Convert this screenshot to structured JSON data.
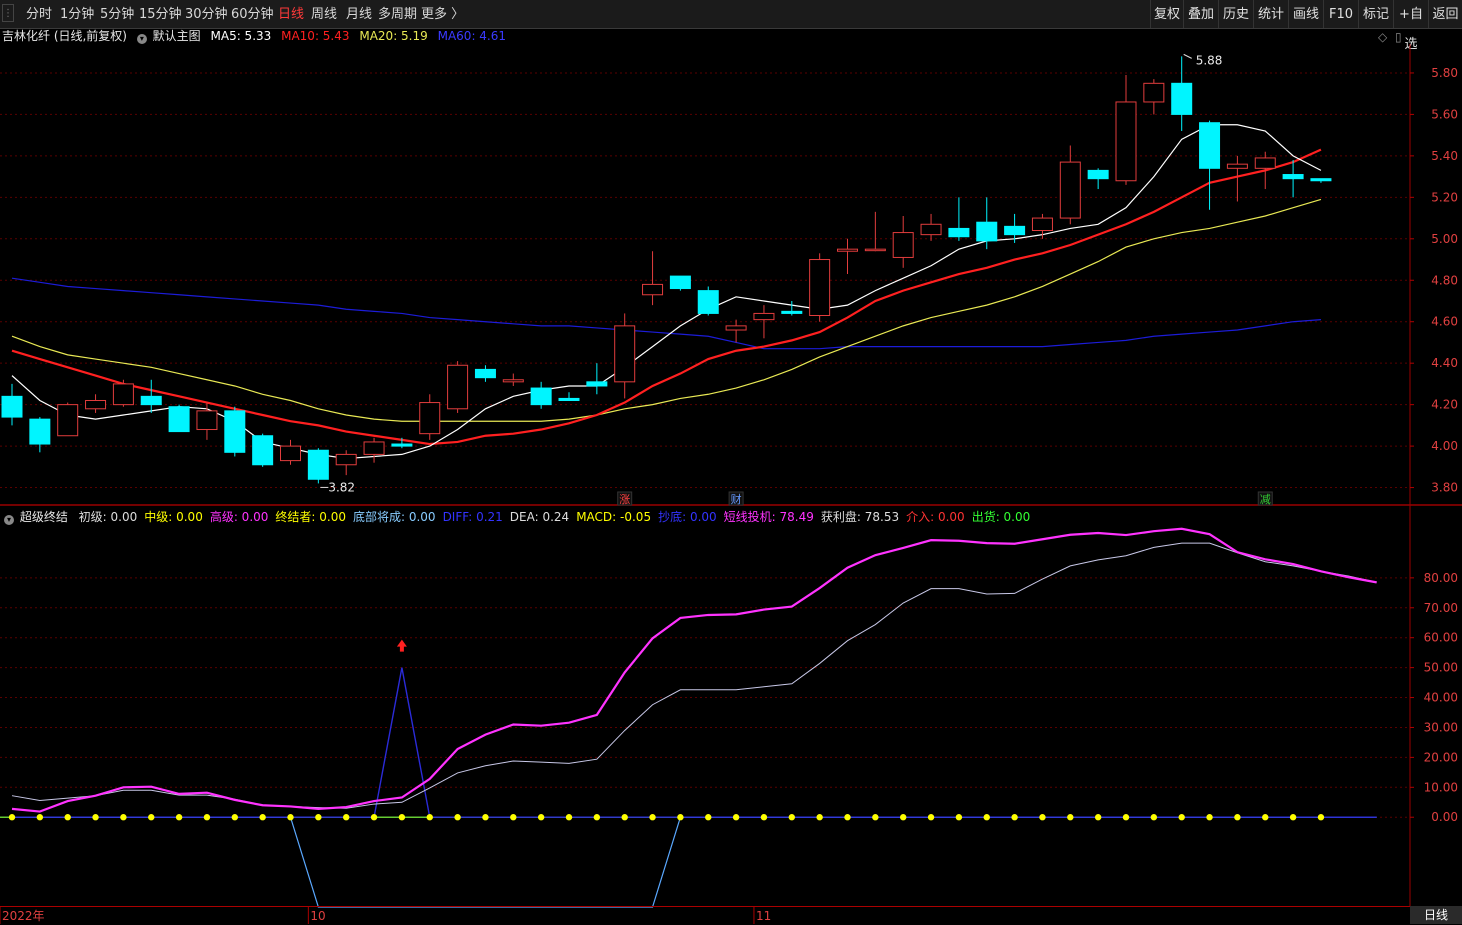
{
  "toolbar": {
    "timeframes": [
      "分时",
      "1分钟",
      "5分钟",
      "15分钟",
      "30分钟",
      "60分钟",
      "日线",
      "周线",
      "月线",
      "多周期",
      "更多 〉"
    ],
    "active_index": 6,
    "right_buttons": [
      "复权",
      "叠加",
      "历史",
      "统计",
      "画线",
      "F10",
      "标记",
      "+自选",
      "返回"
    ]
  },
  "colors": {
    "up": "#e23d3d",
    "down": "#00f5ff",
    "ma5": "#ffffff",
    "ma10": "#ff2020",
    "ma20": "#e8e854",
    "ma60": "#1c1cd8",
    "strategy": "#ff33ff",
    "profit": "#c8c8e8",
    "bottom_line": "#2b2bd8",
    "zero_line": "#66cc33",
    "dot": "#ffff00"
  },
  "main_info": {
    "stock": "吉林化纤 (日线,前复权)",
    "template": "默认主图",
    "ma5": "MA5: 5.33",
    "ma10": "MA10: 5.43",
    "ma20": "MA20: 5.19",
    "ma60": "MA60: 4.61"
  },
  "sub_info": {
    "name": "超级终结",
    "items": [
      {
        "label": "初级: 0.00",
        "color": "#dddddd"
      },
      {
        "label": "中级: 0.00",
        "color": "#ffff00"
      },
      {
        "label": "高级: 0.00",
        "color": "#ff33ff"
      },
      {
        "label": "终结者: 0.00",
        "color": "#ffff00"
      },
      {
        "label": "底部将成: 0.00",
        "color": "#88ccff"
      },
      {
        "label": "DIFF: 0.21",
        "color": "#3333ff"
      },
      {
        "label": "DEA: 0.24",
        "color": "#dddddd"
      },
      {
        "label": "MACD: -0.05",
        "color": "#ffff00"
      },
      {
        "label": "抄底: 0.00",
        "color": "#3333ff"
      },
      {
        "label": "短线投机: 78.49",
        "color": "#ff33ff"
      },
      {
        "label": "获利盘: 78.53",
        "color": "#dddddd"
      },
      {
        "label": "介入: 0.00",
        "color": "#ff3333"
      },
      {
        "label": "出货: 0.00",
        "color": "#33ff33"
      }
    ]
  },
  "markers": [
    {
      "label": "涨",
      "index": 22,
      "color": "#ff4040"
    },
    {
      "label": "财",
      "index": 26,
      "color": "#6699ff"
    },
    {
      "label": "减",
      "index": 45,
      "color": "#33cc33"
    }
  ],
  "annotations": {
    "high": "5.88",
    "low": "3.82"
  },
  "x_labels": [
    {
      "label": "2022年",
      "index": 0
    },
    {
      "label": "10",
      "index": 11
    },
    {
      "label": "11",
      "index": 27
    }
  ],
  "bottom_tab": "日线",
  "chart_data": [
    {
      "type": "candlestick",
      "title": "吉林化纤 (日线,前复权)",
      "ylim": [
        3.74,
        5.93
      ],
      "y_ticks": [
        3.8,
        4.0,
        4.2,
        4.4,
        4.6,
        4.8,
        5.0,
        5.2,
        5.4,
        5.6,
        5.8
      ],
      "candles": [
        {
          "o": 4.24,
          "h": 4.3,
          "l": 4.1,
          "c": 4.14
        },
        {
          "o": 4.13,
          "h": 4.14,
          "l": 3.97,
          "c": 4.01
        },
        {
          "o": 4.05,
          "h": 4.21,
          "l": 4.05,
          "c": 4.2
        },
        {
          "o": 4.18,
          "h": 4.25,
          "l": 4.16,
          "c": 4.22
        },
        {
          "o": 4.2,
          "h": 4.32,
          "l": 4.19,
          "c": 4.3
        },
        {
          "o": 4.24,
          "h": 4.32,
          "l": 4.16,
          "c": 4.2
        },
        {
          "o": 4.19,
          "h": 4.2,
          "l": 4.07,
          "c": 4.07
        },
        {
          "o": 4.08,
          "h": 4.21,
          "l": 4.03,
          "c": 4.17
        },
        {
          "o": 4.17,
          "h": 4.19,
          "l": 3.95,
          "c": 3.97
        },
        {
          "o": 4.05,
          "h": 4.06,
          "l": 3.9,
          "c": 3.91
        },
        {
          "o": 3.93,
          "h": 4.03,
          "l": 3.91,
          "c": 4.0
        },
        {
          "o": 3.98,
          "h": 3.99,
          "l": 3.82,
          "c": 3.84
        },
        {
          "o": 3.91,
          "h": 3.98,
          "l": 3.86,
          "c": 3.96
        },
        {
          "o": 3.96,
          "h": 4.04,
          "l": 3.92,
          "c": 4.02
        },
        {
          "o": 4.01,
          "h": 4.04,
          "l": 3.99,
          "c": 4.0
        },
        {
          "o": 4.06,
          "h": 4.25,
          "l": 4.03,
          "c": 4.21
        },
        {
          "o": 4.18,
          "h": 4.41,
          "l": 4.16,
          "c": 4.39
        },
        {
          "o": 4.37,
          "h": 4.39,
          "l": 4.31,
          "c": 4.33
        },
        {
          "o": 4.31,
          "h": 4.35,
          "l": 4.29,
          "c": 4.32
        },
        {
          "o": 4.28,
          "h": 4.31,
          "l": 4.18,
          "c": 4.2
        },
        {
          "o": 4.23,
          "h": 4.26,
          "l": 4.22,
          "c": 4.22
        },
        {
          "o": 4.31,
          "h": 4.4,
          "l": 4.25,
          "c": 4.29
        },
        {
          "o": 4.31,
          "h": 4.64,
          "l": 4.23,
          "c": 4.58
        },
        {
          "o": 4.73,
          "h": 4.94,
          "l": 4.68,
          "c": 4.78
        },
        {
          "o": 4.82,
          "h": 4.82,
          "l": 4.75,
          "c": 4.76
        },
        {
          "o": 4.75,
          "h": 4.77,
          "l": 4.63,
          "c": 4.64
        },
        {
          "o": 4.56,
          "h": 4.61,
          "l": 4.5,
          "c": 4.58
        },
        {
          "o": 4.61,
          "h": 4.68,
          "l": 4.52,
          "c": 4.64
        },
        {
          "o": 4.65,
          "h": 4.7,
          "l": 4.63,
          "c": 4.64
        },
        {
          "o": 4.63,
          "h": 4.93,
          "l": 4.6,
          "c": 4.9
        },
        {
          "o": 4.94,
          "h": 5.0,
          "l": 4.83,
          "c": 4.95
        },
        {
          "o": 4.95,
          "h": 5.13,
          "l": 4.94,
          "c": 4.95
        },
        {
          "o": 4.91,
          "h": 5.11,
          "l": 4.86,
          "c": 5.03
        },
        {
          "o": 5.02,
          "h": 5.12,
          "l": 4.99,
          "c": 5.07
        },
        {
          "o": 5.05,
          "h": 5.2,
          "l": 4.99,
          "c": 5.01
        },
        {
          "o": 5.08,
          "h": 5.2,
          "l": 4.95,
          "c": 4.99
        },
        {
          "o": 5.06,
          "h": 5.12,
          "l": 4.98,
          "c": 5.02
        },
        {
          "o": 5.04,
          "h": 5.12,
          "l": 5.0,
          "c": 5.1
        },
        {
          "o": 5.1,
          "h": 5.45,
          "l": 5.07,
          "c": 5.37
        },
        {
          "o": 5.33,
          "h": 5.34,
          "l": 5.24,
          "c": 5.29
        },
        {
          "o": 5.28,
          "h": 5.79,
          "l": 5.26,
          "c": 5.66
        },
        {
          "o": 5.66,
          "h": 5.77,
          "l": 5.6,
          "c": 5.75
        },
        {
          "o": 5.75,
          "h": 5.88,
          "l": 5.52,
          "c": 5.6
        },
        {
          "o": 5.56,
          "h": 5.57,
          "l": 5.14,
          "c": 5.34
        },
        {
          "o": 5.34,
          "h": 5.4,
          "l": 5.18,
          "c": 5.36
        },
        {
          "o": 5.34,
          "h": 5.42,
          "l": 5.24,
          "c": 5.39
        },
        {
          "o": 5.31,
          "h": 5.38,
          "l": 5.2,
          "c": 5.29
        },
        {
          "o": 5.29,
          "h": 5.29,
          "l": 5.27,
          "c": 5.28
        }
      ],
      "series": [
        {
          "name": "MA5",
          "values": [
            4.34,
            4.22,
            4.15,
            4.13,
            4.15,
            4.17,
            4.19,
            4.18,
            4.12,
            4.02,
            3.99,
            3.96,
            3.94,
            3.95,
            3.96,
            4.0,
            4.08,
            4.18,
            4.24,
            4.27,
            4.29,
            4.29,
            4.38,
            4.48,
            4.58,
            4.66,
            4.72,
            4.7,
            4.68,
            4.66,
            4.68,
            4.75,
            4.81,
            4.87,
            4.95,
            4.99,
            5.0,
            5.02,
            5.05,
            5.07,
            5.15,
            5.3,
            5.48,
            5.55,
            5.55,
            5.52,
            5.4,
            5.33
          ]
        },
        {
          "name": "MA10",
          "values": [
            4.46,
            4.42,
            4.38,
            4.34,
            4.3,
            4.27,
            4.24,
            4.21,
            4.18,
            4.15,
            4.12,
            4.1,
            4.07,
            4.05,
            4.03,
            4.01,
            4.02,
            4.05,
            4.06,
            4.08,
            4.11,
            4.15,
            4.21,
            4.29,
            4.35,
            4.42,
            4.46,
            4.48,
            4.51,
            4.55,
            4.62,
            4.7,
            4.75,
            4.79,
            4.83,
            4.86,
            4.9,
            4.93,
            4.97,
            5.02,
            5.07,
            5.13,
            5.2,
            5.27,
            5.3,
            5.33,
            5.37,
            5.43
          ]
        },
        {
          "name": "MA20",
          "values": [
            4.53,
            4.48,
            4.44,
            4.42,
            4.4,
            4.38,
            4.35,
            4.32,
            4.29,
            4.25,
            4.22,
            4.18,
            4.15,
            4.13,
            4.12,
            4.12,
            4.12,
            4.12,
            4.12,
            4.12,
            4.13,
            4.15,
            4.18,
            4.2,
            4.23,
            4.25,
            4.28,
            4.32,
            4.37,
            4.43,
            4.48,
            4.53,
            4.58,
            4.62,
            4.65,
            4.68,
            4.72,
            4.77,
            4.83,
            4.89,
            4.96,
            5.0,
            5.03,
            5.05,
            5.08,
            5.11,
            5.15,
            5.19
          ]
        },
        {
          "name": "MA60",
          "values": [
            4.81,
            4.79,
            4.77,
            4.76,
            4.75,
            4.74,
            4.73,
            4.72,
            4.71,
            4.7,
            4.69,
            4.68,
            4.66,
            4.65,
            4.64,
            4.62,
            4.61,
            4.6,
            4.59,
            4.58,
            4.58,
            4.57,
            4.56,
            4.55,
            4.54,
            4.53,
            4.5,
            4.47,
            4.47,
            4.47,
            4.48,
            4.48,
            4.48,
            4.48,
            4.48,
            4.48,
            4.48,
            4.48,
            4.49,
            4.5,
            4.51,
            4.53,
            4.54,
            4.55,
            4.56,
            4.58,
            4.6,
            4.61
          ]
        }
      ]
    },
    {
      "type": "line",
      "title": "超级终结",
      "ylim": [
        -29,
        97
      ],
      "y_ticks": [
        0,
        10,
        20,
        30,
        40,
        50,
        60,
        70,
        80
      ],
      "series": [
        {
          "name": "短线投机",
          "values": [
            2.8,
            1.9,
            5.4,
            7.2,
            10.0,
            10.2,
            7.8,
            8.2,
            5.8,
            4.0,
            3.6,
            2.8,
            3.4,
            5.4,
            6.6,
            12.8,
            22.8,
            27.6,
            31.0,
            30.6,
            31.6,
            34.2,
            48.4,
            59.8,
            66.6,
            67.6,
            67.8,
            69.4,
            70.4,
            76.6,
            83.4,
            87.6,
            90.0,
            92.6,
            92.4,
            91.6,
            91.4,
            92.9,
            94.4,
            95.0,
            94.3,
            95.6,
            96.4,
            94.6,
            88.6,
            86.2,
            84.6,
            82.2,
            80.2,
            78.49
          ]
        },
        {
          "name": "获利盘",
          "values": [
            7.2,
            5.6,
            6.4,
            7.2,
            9.0,
            9.0,
            7.4,
            7.4,
            6.0,
            4.0,
            3.6,
            3.2,
            3.0,
            4.4,
            5.0,
            9.8,
            14.8,
            17.2,
            18.8,
            18.4,
            18.0,
            19.4,
            29.0,
            37.6,
            42.6,
            42.6,
            42.6,
            43.6,
            44.6,
            51.4,
            59.0,
            64.4,
            71.6,
            76.4,
            76.4,
            74.6,
            74.8,
            79.6,
            84.0,
            86.0,
            87.4,
            90.2,
            91.6,
            91.6,
            88.4,
            85.4,
            84.0,
            82.2,
            80.6,
            78.53
          ]
        },
        {
          "name": "抄底",
          "values": [
            0,
            0,
            0,
            0,
            0,
            0,
            0,
            0,
            0,
            0,
            0,
            0,
            0,
            0,
            50,
            0,
            0,
            0,
            0,
            0,
            0,
            0,
            0,
            0,
            0,
            0,
            0,
            0,
            0,
            0,
            0,
            0,
            0,
            0,
            0,
            0,
            0,
            0,
            0,
            0,
            0,
            0,
            0,
            0,
            0,
            0,
            0,
            0,
            0,
            0
          ]
        },
        {
          "name": "底部将成",
          "values": [
            0,
            0,
            0,
            0,
            0,
            0,
            0,
            0,
            0,
            0,
            0,
            -30,
            -30,
            -30,
            -30,
            -30,
            -30,
            -30,
            -30,
            -30,
            -30,
            -30,
            -30,
            -30,
            0,
            0,
            0,
            0,
            0,
            0,
            0,
            0,
            0,
            0,
            0,
            0,
            0,
            0,
            0,
            0,
            0,
            0,
            0,
            0,
            0,
            0,
            0,
            0,
            0,
            0
          ]
        }
      ],
      "signal_up_index": 14
    }
  ]
}
